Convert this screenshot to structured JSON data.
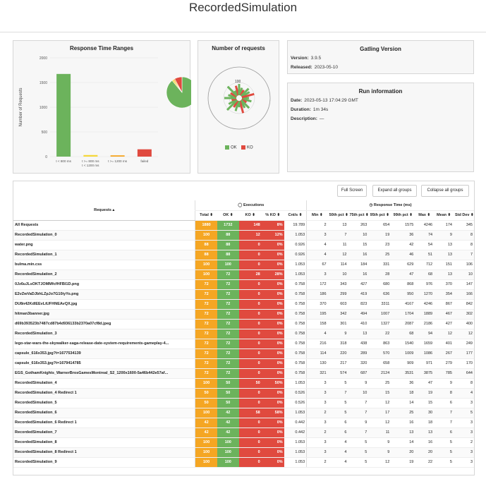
{
  "header": {
    "title": "RecordedSimulation"
  },
  "response_time_panel": {
    "title": "Response Time Ranges",
    "chart_data": {
      "type": "bar",
      "title": "Response Time Ranges",
      "ylabel": "Number of Requests",
      "categories": [
        "t < 800 ms",
        "t >= 800 ms\nt < 1200 ms",
        "t >= 1200 ms",
        "failed"
      ],
      "category_lines": [
        [
          "t < 800 ms"
        ],
        [
          "t >= 800 ms",
          "t < 1200 ms"
        ],
        [
          "t >= 1200 ms"
        ],
        [
          "failed"
        ]
      ],
      "values": [
        1674,
        32,
        26,
        148
      ],
      "colors": [
        "#6cb35c",
        "#f5d73a",
        "#f5a623",
        "#e04a3f"
      ],
      "ylim": [
        0,
        2000
      ],
      "yticks": [
        "0",
        "500",
        "1000",
        "1500",
        "2000"
      ],
      "ytick_values": [
        0,
        500,
        1000,
        1500,
        2000
      ]
    },
    "pie": {
      "type": "pie",
      "values": [
        1674,
        32,
        26,
        148
      ],
      "colors": [
        "#6cb35c",
        "#f5d73a",
        "#f5a623",
        "#e04a3f"
      ]
    }
  },
  "requests_panel": {
    "title": "Number of requests",
    "radial_label": "100",
    "legend": [
      {
        "label": "OK",
        "color": "#6cb35c"
      },
      {
        "label": "KO",
        "color": "#e04a3f"
      }
    ]
  },
  "gatling_version": {
    "title": "Gatling Version",
    "version_label": "Version:",
    "version_value": "3.9.5",
    "released_label": "Released:",
    "released_value": "2023-05-10"
  },
  "run_info": {
    "title": "Run information",
    "date_label": "Date:",
    "date_value": "2023-05-13 17:04:29 GMT",
    "duration_label": "Duration:",
    "duration_value": "1m 34s",
    "description_label": "Description:",
    "description_value": "—"
  },
  "toolbar": {
    "full_screen": "Full Screen",
    "expand_all": "Expand all groups",
    "collapse_all": "Collapse all groups"
  },
  "table": {
    "group_executions": "Executions",
    "group_response_time": "Response Time (ms)",
    "headers": {
      "requests": "Requests ▴",
      "total": "Total ⬍",
      "ok": "OK ⬍",
      "ko": "KO ⬍",
      "ko_pct": "% KO ⬍",
      "cnt": "Cnt/s ⬍",
      "min": "Min ⬍",
      "p50": "50th pct ⬍",
      "p75": "75th pct ⬍",
      "p95": "95th pct ⬍",
      "p99": "99th pct ⬍",
      "max": "Max ⬍",
      "mean": "Mean ⬍",
      "std": "Std Dev ⬍"
    },
    "rows": [
      [
        "All Requests",
        "1880",
        "1732",
        "148",
        "8%",
        "19.789",
        "2",
        "13",
        "263",
        "654",
        "1575",
        "4246",
        "174",
        "345"
      ],
      [
        "RecordedSimulation_0",
        "100",
        "88",
        "12",
        "12%",
        "1.053",
        "3",
        "7",
        "10",
        "19",
        "36",
        "74",
        "9",
        "8"
      ],
      [
        "water.png",
        "88",
        "88",
        "0",
        "0%",
        "0.926",
        "4",
        "11",
        "15",
        "23",
        "42",
        "54",
        "13",
        "8"
      ],
      [
        "RecordedSimulation_1",
        "88",
        "88",
        "0",
        "0%",
        "0.926",
        "4",
        "12",
        "16",
        "25",
        "46",
        "51",
        "13",
        "7"
      ],
      [
        "bulma.min.css",
        "100",
        "100",
        "0",
        "0%",
        "1.053",
        "67",
        "114",
        "184",
        "331",
        "629",
        "712",
        "151",
        "106"
      ],
      [
        "RecordedSimulation_2",
        "100",
        "72",
        "28",
        "28%",
        "1.053",
        "3",
        "10",
        "16",
        "28",
        "47",
        "68",
        "13",
        "10"
      ],
      [
        "0Jz6uJLsOKTJOMMfcfHFBl1D.png",
        "72",
        "72",
        "0",
        "0%",
        "0.758",
        "172",
        "343",
        "427",
        "680",
        "868",
        "976",
        "370",
        "147"
      ],
      [
        "E2vZwVaDJbhLZpJo7G10iyYo.png",
        "72",
        "72",
        "0",
        "0%",
        "0.758",
        "186",
        "299",
        "419",
        "636",
        "950",
        "1270",
        "354",
        "166"
      ],
      [
        "DU8n42KdlEEvLtUFHNEAvQX.jpg",
        "72",
        "72",
        "0",
        "0%",
        "0.758",
        "370",
        "603",
        "823",
        "3311",
        "4167",
        "4246",
        "867",
        "842"
      ],
      [
        "hitman3banner.jpg",
        "72",
        "72",
        "0",
        "0%",
        "0.758",
        "195",
        "342",
        "494",
        "1007",
        "1704",
        "1889",
        "467",
        "302"
      ],
      [
        "d69b393523b7487cd87b4d936133b2370a07cf8d.jpeg",
        "72",
        "72",
        "0",
        "0%",
        "0.758",
        "158",
        "301",
        "410",
        "1327",
        "2087",
        "2186",
        "427",
        "400"
      ],
      [
        "RecordedSimulation_3",
        "72",
        "72",
        "0",
        "0%",
        "0.758",
        "4",
        "9",
        "13",
        "22",
        "68",
        "94",
        "12",
        "12"
      ],
      [
        "lego-star-wars-the-skywalker-saga-release-date-system-requirements-gameplay-4...",
        "72",
        "72",
        "0",
        "0%",
        "0.758",
        "216",
        "318",
        "438",
        "863",
        "1540",
        "1659",
        "401",
        "249"
      ],
      [
        "capsule_616x353.jpg?t=1677534139",
        "72",
        "72",
        "0",
        "0%",
        "0.758",
        "114",
        "220",
        "289",
        "570",
        "1009",
        "1086",
        "267",
        "177"
      ],
      [
        "capsule_616x353.jpg?t=1679414785",
        "72",
        "72",
        "0",
        "0%",
        "0.758",
        "130",
        "217",
        "320",
        "658",
        "909",
        "971",
        "279",
        "170"
      ],
      [
        "EGS_GothamKnights_WarnerBrosGamesMontreal_S2_1200x1600-5a46b442e57af...",
        "72",
        "72",
        "0",
        "0%",
        "0.758",
        "321",
        "574",
        "687",
        "2124",
        "3531",
        "3875",
        "785",
        "644"
      ],
      [
        "RecordedSimulation_4",
        "100",
        "50",
        "50",
        "50%",
        "1.053",
        "3",
        "5",
        "9",
        "25",
        "36",
        "47",
        "9",
        "8"
      ],
      [
        "RecordedSimulation_4 Redirect 1",
        "50",
        "50",
        "0",
        "0%",
        "0.526",
        "3",
        "7",
        "10",
        "15",
        "18",
        "19",
        "8",
        "4"
      ],
      [
        "RecordedSimulation_5",
        "50",
        "50",
        "0",
        "0%",
        "0.526",
        "3",
        "5",
        "7",
        "12",
        "14",
        "15",
        "6",
        "3"
      ],
      [
        "RecordedSimulation_6",
        "100",
        "42",
        "58",
        "58%",
        "1.053",
        "2",
        "5",
        "7",
        "17",
        "25",
        "30",
        "7",
        "5"
      ],
      [
        "RecordedSimulation_6 Redirect 1",
        "42",
        "42",
        "0",
        "0%",
        "0.442",
        "3",
        "6",
        "9",
        "12",
        "16",
        "18",
        "7",
        "3"
      ],
      [
        "RecordedSimulation_7",
        "42",
        "42",
        "0",
        "0%",
        "0.442",
        "2",
        "6",
        "7",
        "11",
        "13",
        "13",
        "6",
        "3"
      ],
      [
        "RecordedSimulation_8",
        "100",
        "100",
        "0",
        "0%",
        "1.053",
        "3",
        "4",
        "5",
        "9",
        "14",
        "16",
        "5",
        "2"
      ],
      [
        "RecordedSimulation_8 Redirect 1",
        "100",
        "100",
        "0",
        "0%",
        "1.053",
        "3",
        "4",
        "5",
        "9",
        "20",
        "20",
        "5",
        "3"
      ],
      [
        "RecordedSimulation_9",
        "100",
        "100",
        "0",
        "0%",
        "1.053",
        "2",
        "4",
        "5",
        "12",
        "19",
        "22",
        "5",
        "3"
      ]
    ]
  }
}
